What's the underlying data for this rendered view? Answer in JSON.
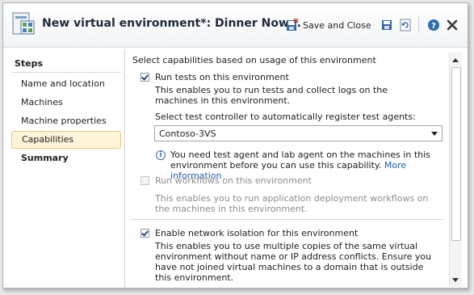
{
  "window": {
    "title": "New virtual environment*: Dinner Now...",
    "toolbar": {
      "save_close_label": "Save and Close"
    },
    "icons": {
      "app": "environment-grid-icon",
      "save_close": "save-and-close-icon",
      "save": "save-icon",
      "refresh": "refresh-icon",
      "help": "help-icon",
      "close": "close-icon"
    }
  },
  "sidebar": {
    "title": "Steps",
    "items": [
      {
        "label": "Name and location",
        "selected": false,
        "bold": false
      },
      {
        "label": "Machines",
        "selected": false,
        "bold": false
      },
      {
        "label": "Machine properties",
        "selected": false,
        "bold": false
      },
      {
        "label": "Capabilities",
        "selected": true,
        "bold": false
      },
      {
        "label": "Summary",
        "selected": false,
        "bold": true
      }
    ]
  },
  "main": {
    "heading": "Select capabilities based on usage of this environment",
    "run_tests": {
      "label": "Run tests on this environment",
      "checked": true,
      "description": "This enables you to run tests and collect logs on the machines in this environment.",
      "controller_label": "Select test controller to automatically register test agents:",
      "controller_value": "Contoso-3VS",
      "info_text": "You need test agent and lab agent on the machines in this environment before you can use this capability.",
      "info_link": "More information"
    },
    "run_workflows": {
      "label": "Run workflows on this environment",
      "checked": false,
      "disabled": true,
      "description": "This enables you to run application deployment workflows on the machines in this environment."
    },
    "network_isolation": {
      "label": "Enable network isolation for this environment",
      "checked": true,
      "description": "This enables you to use multiple copies of the same virtual environment without name or IP address conflicts. Ensure you have not joined virtual machines to a domain that is outside this environment."
    }
  },
  "colors": {
    "selected_bg": "#fdf4d9",
    "selected_border": "#e8cc78",
    "link": "#1f5fb4"
  }
}
